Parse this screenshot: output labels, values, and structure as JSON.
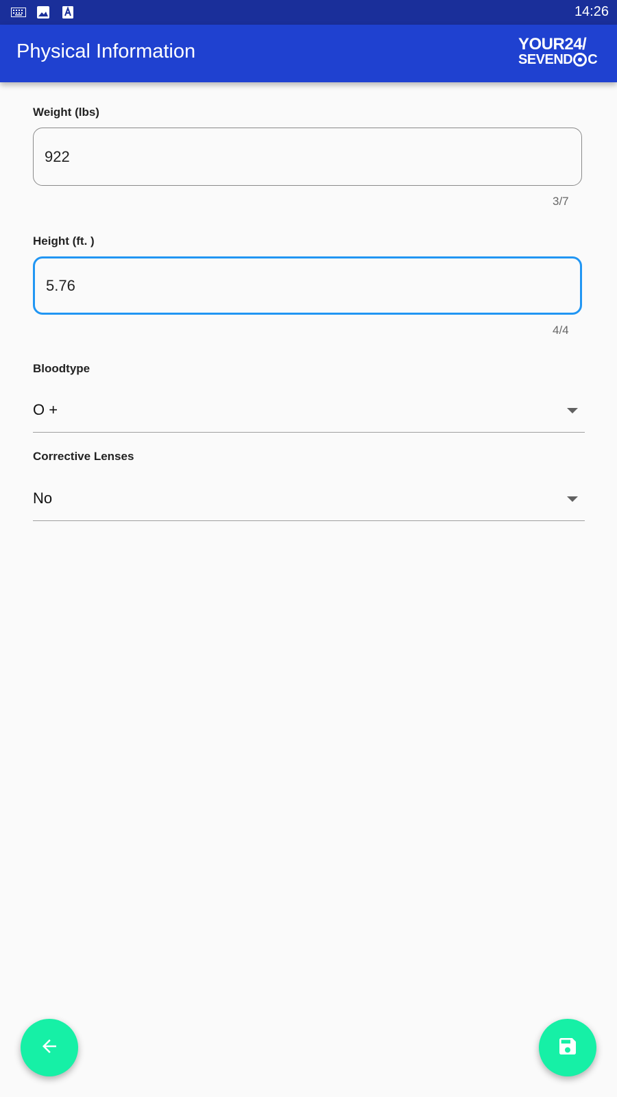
{
  "status_bar": {
    "time": "14:26",
    "icons": [
      "keyboard-icon",
      "image-icon",
      "text-a-icon"
    ]
  },
  "app_bar": {
    "title": "Physical Information",
    "logo_line1": "YOUR24/",
    "logo_line2_a": "SEVEND",
    "logo_line2_b": "C"
  },
  "form": {
    "weight": {
      "label": "Weight (lbs)",
      "value": "922",
      "counter": "3/7"
    },
    "height": {
      "label": "Height (ft. )",
      "value": "5.76",
      "counter": "4/4"
    },
    "bloodtype": {
      "label": "Bloodtype",
      "value": "O +"
    },
    "corrective_lenses": {
      "label": "Corrective Lenses",
      "value": "No"
    }
  },
  "colors": {
    "status_bar": "#1a2f9a",
    "app_bar": "#1f41d0",
    "focus_border": "#2196f3",
    "fab": "#16f0a6"
  },
  "fabs": {
    "back_icon": "arrow-left-icon",
    "save_icon": "save-icon"
  }
}
